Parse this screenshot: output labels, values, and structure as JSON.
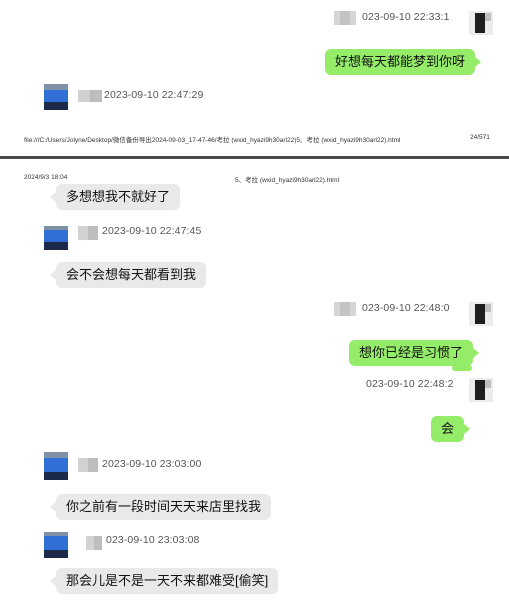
{
  "page1": {
    "footer_path": "file:///C:/Users/Jolyne/Desktop/微信备份导出2024-09-03_17-47-46/考拉 (wxid_hyazi9h30arl22)5、考拉 (wxid_hyazi9h30arl22).html",
    "footer_page": "24/571"
  },
  "page2": {
    "header_date": "2024/9/3 18:04",
    "header_title": "5、考拉 (wxid_hyazi9h30arl22).html"
  },
  "messages": [
    {
      "side": "me",
      "time": "023-09-10 22:33:1",
      "text": "好想每天都能梦到你呀"
    },
    {
      "side": "other",
      "time": "2023-09-10 22:47:29"
    },
    {
      "side": "other",
      "text": "多想想我不就好了"
    },
    {
      "side": "other",
      "time": "2023-09-10 22:47:45",
      "text": "会不会想每天都看到我"
    },
    {
      "side": "me",
      "time": "023-09-10 22:48:0",
      "text": "想你已经是习惯了"
    },
    {
      "side": "me",
      "time": "023-09-10 22:48:2",
      "text": "会"
    },
    {
      "side": "other",
      "time": "2023-09-10 23:03:00",
      "text": "你之前有一段时间天天来店里找我"
    },
    {
      "side": "other",
      "time": "023-09-10 23:03:08",
      "text": "那会儿是不是一天不来都难受[偷笑]"
    }
  ],
  "colors": {
    "my_bubble": "#95ec69",
    "other_bubble": "#e9e9e9",
    "avatar_blue": "#2f6fd6"
  }
}
